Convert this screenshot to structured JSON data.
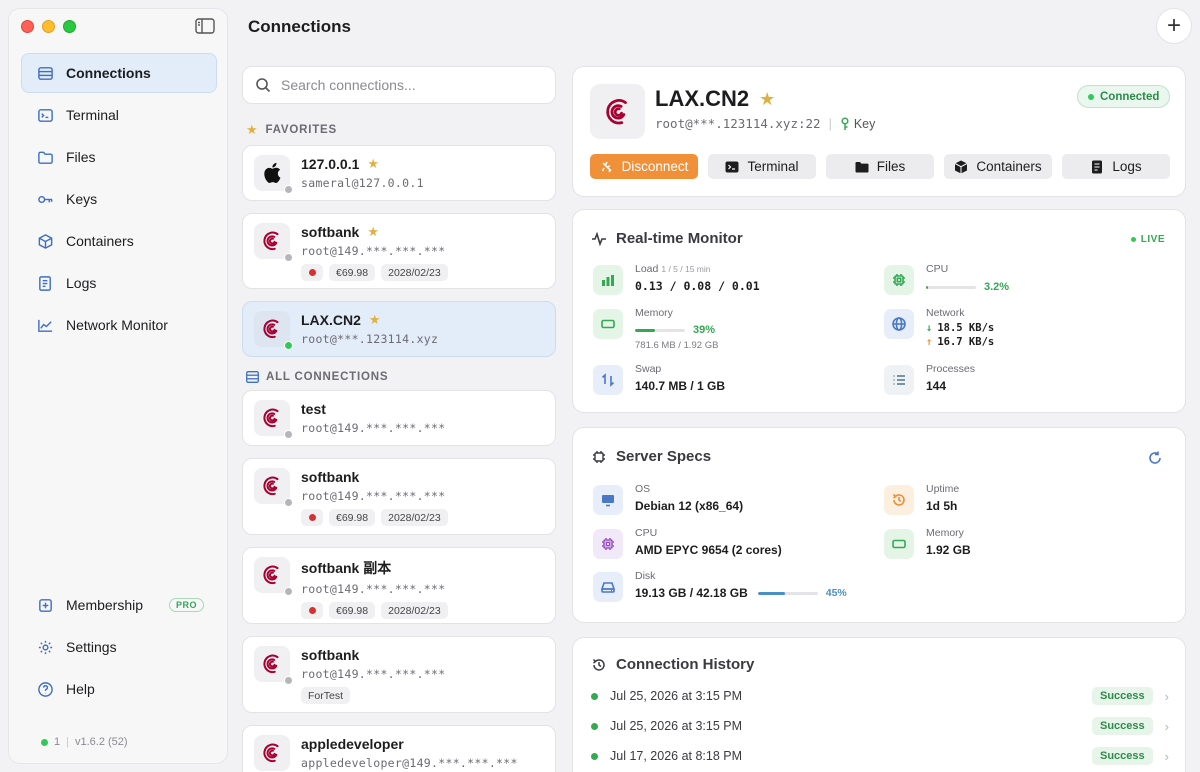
{
  "app": {
    "page_title": "Connections",
    "add_label": "+"
  },
  "sidebar": {
    "items": [
      {
        "label": "Connections",
        "icon": "server-stack-icon",
        "active": true
      },
      {
        "label": "Terminal",
        "icon": "terminal-icon"
      },
      {
        "label": "Files",
        "icon": "folder-icon"
      },
      {
        "label": "Keys",
        "icon": "key-icon"
      },
      {
        "label": "Containers",
        "icon": "box-icon"
      },
      {
        "label": "Logs",
        "icon": "logs-icon"
      },
      {
        "label": "Network Monitor",
        "icon": "chart-line-icon"
      }
    ],
    "bottom_items": [
      {
        "label": "Membership",
        "icon": "membership-icon",
        "badge": "PRO"
      },
      {
        "label": "Settings",
        "icon": "gear-icon"
      },
      {
        "label": "Help",
        "icon": "help-icon"
      }
    ],
    "status_count": "1",
    "version": "v1.6.2 (52)"
  },
  "search": {
    "placeholder": "Search connections..."
  },
  "favorites_label": "FAVORITES",
  "all_label": "ALL CONNECTIONS",
  "favorites": [
    {
      "name": "127.0.0.1",
      "host": "sameral@127.0.0.1",
      "star": "★",
      "avatar": "apple-icon",
      "online": false,
      "tags": []
    },
    {
      "name": "softbank",
      "host": "root@149.***.***.***",
      "star": "★",
      "avatar": "debian-icon",
      "online": false,
      "tags": [
        "flag",
        "€69.98",
        "2028/02/23"
      ]
    },
    {
      "name": "LAX.CN2",
      "host": "root@***.123114.xyz",
      "star": "★",
      "avatar": "debian-icon",
      "online": true,
      "active": true,
      "tags": []
    }
  ],
  "all_connections": [
    {
      "name": "test",
      "host": "root@149.***.***.***",
      "online": false,
      "tags": []
    },
    {
      "name": "softbank",
      "host": "root@149.***.***.***",
      "online": false,
      "tags": [
        "flag",
        "€69.98",
        "2028/02/23"
      ]
    },
    {
      "name": "softbank 副本",
      "host": "root@149.***.***.***",
      "online": false,
      "tags": [
        "flag",
        "€69.98",
        "2028/02/23"
      ]
    },
    {
      "name": "softbank",
      "host": "root@149.***.***.***",
      "online": false,
      "tags": [
        "ForTest"
      ]
    },
    {
      "name": "appledeveloper",
      "host": "appledeveloper@149.***.***.***",
      "online": false,
      "tags": []
    }
  ],
  "detail": {
    "title": "LAX.CN2",
    "star": "★",
    "address": "root@***.123114.xyz:22",
    "divider": "|",
    "auth": "Key",
    "status": "Connected",
    "actions": {
      "disconnect": "Disconnect",
      "terminal": "Terminal",
      "files": "Files",
      "containers": "Containers",
      "logs": "Logs"
    }
  },
  "monitor": {
    "title": "Real-time Monitor",
    "live": "LIVE",
    "load": {
      "label": "Load",
      "sub": "1 / 5 / 15 min",
      "value": "0.13  /  0.08  /  0.01"
    },
    "cpu": {
      "label": "CPU",
      "value": "3.2%",
      "percent": 3.2
    },
    "memory": {
      "label": "Memory",
      "value": "39%",
      "percent": 39,
      "detail": "781.6 MB / 1.92 GB"
    },
    "network": {
      "label": "Network",
      "down": "18.5 KB/s",
      "up": "16.7 KB/s",
      "down_arrow": "↓",
      "up_arrow": "↑"
    },
    "swap": {
      "label": "Swap",
      "value": "140.7 MB / 1 GB"
    },
    "processes": {
      "label": "Processes",
      "value": "144"
    }
  },
  "specs": {
    "title": "Server Specs",
    "os": {
      "label": "OS",
      "value": "Debian 12 (x86_64)"
    },
    "uptime": {
      "label": "Uptime",
      "value": "1d 5h"
    },
    "cpu": {
      "label": "CPU",
      "value": "AMD EPYC 9654 (2 cores)"
    },
    "memory": {
      "label": "Memory",
      "value": "1.92 GB"
    },
    "disk": {
      "label": "Disk",
      "value": "19.13 GB / 42.18 GB",
      "pct": "45%",
      "percent": 45
    }
  },
  "history": {
    "title": "Connection History",
    "rows": [
      {
        "time": "Jul 25, 2026 at 3:15 PM",
        "result": "Success"
      },
      {
        "time": "Jul 25, 2026 at 3:15 PM",
        "result": "Success"
      },
      {
        "time": "Jul 17, 2026 at 8:18 PM",
        "result": "Success"
      }
    ]
  },
  "colors": {
    "accent": "#3d6fc4",
    "orange": "#f0913a",
    "green": "#34c759",
    "debian": "#a80030"
  }
}
